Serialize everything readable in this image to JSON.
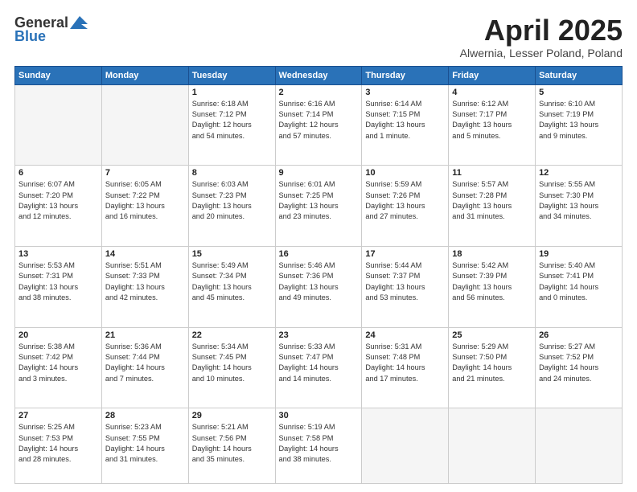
{
  "header": {
    "logo_general": "General",
    "logo_blue": "Blue",
    "month": "April 2025",
    "location": "Alwernia, Lesser Poland, Poland"
  },
  "days_of_week": [
    "Sunday",
    "Monday",
    "Tuesday",
    "Wednesday",
    "Thursday",
    "Friday",
    "Saturday"
  ],
  "weeks": [
    [
      {
        "day": "",
        "info": ""
      },
      {
        "day": "",
        "info": ""
      },
      {
        "day": "1",
        "info": "Sunrise: 6:18 AM\nSunset: 7:12 PM\nDaylight: 12 hours\nand 54 minutes."
      },
      {
        "day": "2",
        "info": "Sunrise: 6:16 AM\nSunset: 7:14 PM\nDaylight: 12 hours\nand 57 minutes."
      },
      {
        "day": "3",
        "info": "Sunrise: 6:14 AM\nSunset: 7:15 PM\nDaylight: 13 hours\nand 1 minute."
      },
      {
        "day": "4",
        "info": "Sunrise: 6:12 AM\nSunset: 7:17 PM\nDaylight: 13 hours\nand 5 minutes."
      },
      {
        "day": "5",
        "info": "Sunrise: 6:10 AM\nSunset: 7:19 PM\nDaylight: 13 hours\nand 9 minutes."
      }
    ],
    [
      {
        "day": "6",
        "info": "Sunrise: 6:07 AM\nSunset: 7:20 PM\nDaylight: 13 hours\nand 12 minutes."
      },
      {
        "day": "7",
        "info": "Sunrise: 6:05 AM\nSunset: 7:22 PM\nDaylight: 13 hours\nand 16 minutes."
      },
      {
        "day": "8",
        "info": "Sunrise: 6:03 AM\nSunset: 7:23 PM\nDaylight: 13 hours\nand 20 minutes."
      },
      {
        "day": "9",
        "info": "Sunrise: 6:01 AM\nSunset: 7:25 PM\nDaylight: 13 hours\nand 23 minutes."
      },
      {
        "day": "10",
        "info": "Sunrise: 5:59 AM\nSunset: 7:26 PM\nDaylight: 13 hours\nand 27 minutes."
      },
      {
        "day": "11",
        "info": "Sunrise: 5:57 AM\nSunset: 7:28 PM\nDaylight: 13 hours\nand 31 minutes."
      },
      {
        "day": "12",
        "info": "Sunrise: 5:55 AM\nSunset: 7:30 PM\nDaylight: 13 hours\nand 34 minutes."
      }
    ],
    [
      {
        "day": "13",
        "info": "Sunrise: 5:53 AM\nSunset: 7:31 PM\nDaylight: 13 hours\nand 38 minutes."
      },
      {
        "day": "14",
        "info": "Sunrise: 5:51 AM\nSunset: 7:33 PM\nDaylight: 13 hours\nand 42 minutes."
      },
      {
        "day": "15",
        "info": "Sunrise: 5:49 AM\nSunset: 7:34 PM\nDaylight: 13 hours\nand 45 minutes."
      },
      {
        "day": "16",
        "info": "Sunrise: 5:46 AM\nSunset: 7:36 PM\nDaylight: 13 hours\nand 49 minutes."
      },
      {
        "day": "17",
        "info": "Sunrise: 5:44 AM\nSunset: 7:37 PM\nDaylight: 13 hours\nand 53 minutes."
      },
      {
        "day": "18",
        "info": "Sunrise: 5:42 AM\nSunset: 7:39 PM\nDaylight: 13 hours\nand 56 minutes."
      },
      {
        "day": "19",
        "info": "Sunrise: 5:40 AM\nSunset: 7:41 PM\nDaylight: 14 hours\nand 0 minutes."
      }
    ],
    [
      {
        "day": "20",
        "info": "Sunrise: 5:38 AM\nSunset: 7:42 PM\nDaylight: 14 hours\nand 3 minutes."
      },
      {
        "day": "21",
        "info": "Sunrise: 5:36 AM\nSunset: 7:44 PM\nDaylight: 14 hours\nand 7 minutes."
      },
      {
        "day": "22",
        "info": "Sunrise: 5:34 AM\nSunset: 7:45 PM\nDaylight: 14 hours\nand 10 minutes."
      },
      {
        "day": "23",
        "info": "Sunrise: 5:33 AM\nSunset: 7:47 PM\nDaylight: 14 hours\nand 14 minutes."
      },
      {
        "day": "24",
        "info": "Sunrise: 5:31 AM\nSunset: 7:48 PM\nDaylight: 14 hours\nand 17 minutes."
      },
      {
        "day": "25",
        "info": "Sunrise: 5:29 AM\nSunset: 7:50 PM\nDaylight: 14 hours\nand 21 minutes."
      },
      {
        "day": "26",
        "info": "Sunrise: 5:27 AM\nSunset: 7:52 PM\nDaylight: 14 hours\nand 24 minutes."
      }
    ],
    [
      {
        "day": "27",
        "info": "Sunrise: 5:25 AM\nSunset: 7:53 PM\nDaylight: 14 hours\nand 28 minutes."
      },
      {
        "day": "28",
        "info": "Sunrise: 5:23 AM\nSunset: 7:55 PM\nDaylight: 14 hours\nand 31 minutes."
      },
      {
        "day": "29",
        "info": "Sunrise: 5:21 AM\nSunset: 7:56 PM\nDaylight: 14 hours\nand 35 minutes."
      },
      {
        "day": "30",
        "info": "Sunrise: 5:19 AM\nSunset: 7:58 PM\nDaylight: 14 hours\nand 38 minutes."
      },
      {
        "day": "",
        "info": ""
      },
      {
        "day": "",
        "info": ""
      },
      {
        "day": "",
        "info": ""
      }
    ]
  ]
}
